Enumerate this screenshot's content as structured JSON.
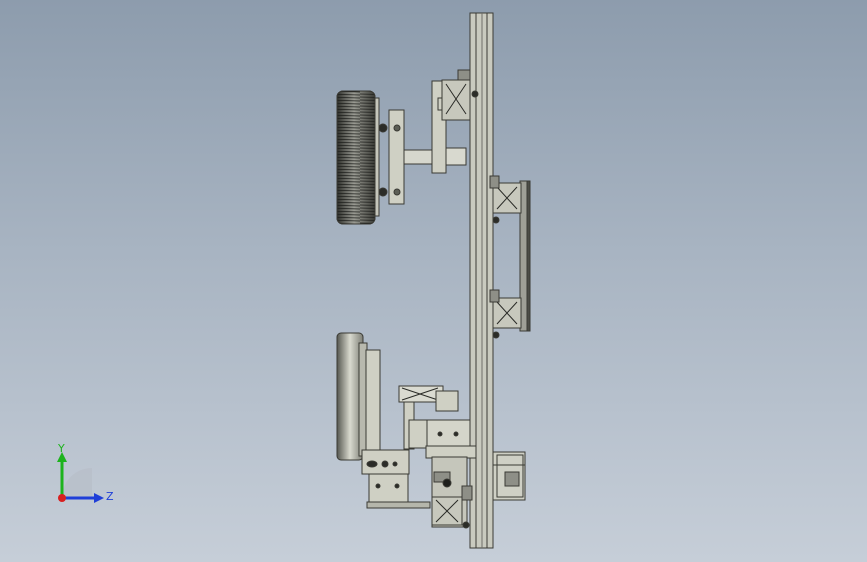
{
  "viewport": {
    "background_top": "#8d9cad",
    "background_bottom": "#c6ced8",
    "part_fill": "#cfd0c4",
    "part_stroke": "#3a3a34",
    "dark_fill": "#5c5e56"
  },
  "triad": {
    "y_label": "Y",
    "z_label": "Z",
    "y_color": "#1db31d",
    "z_color": "#1f3fd8",
    "x_color": "#d81f1f"
  }
}
